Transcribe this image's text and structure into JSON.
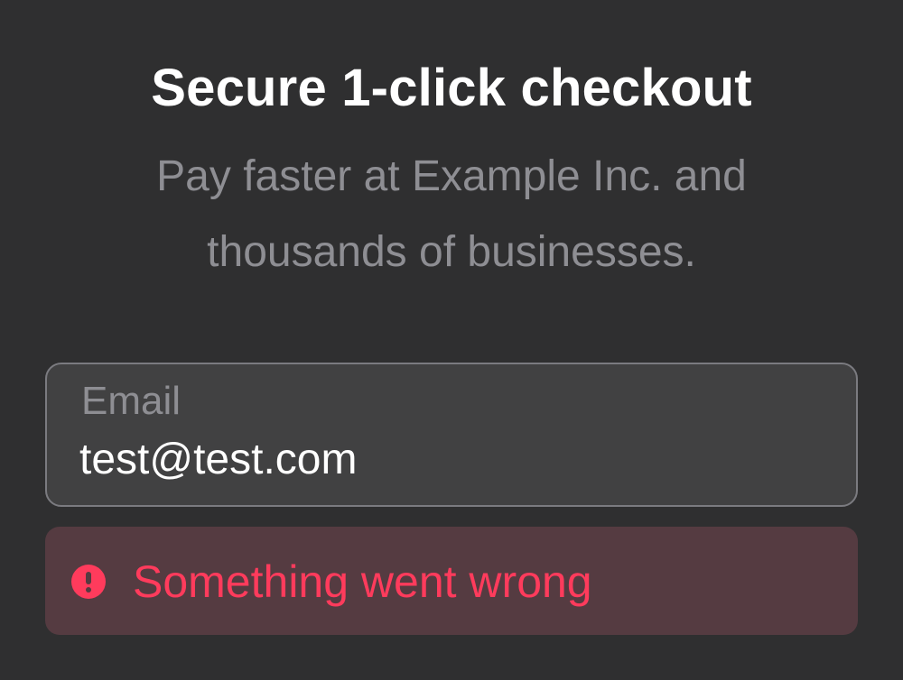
{
  "header": {
    "title": "Secure 1-click checkout",
    "subtitle": "Pay faster at Example Inc. and thousands of businesses."
  },
  "email": {
    "label": "Email",
    "value": "test@test.com"
  },
  "error": {
    "icon": "alert-circle-icon",
    "message": "Something went wrong"
  },
  "colors": {
    "background": "#2f2f30",
    "field_background": "#414142",
    "error_background": "#553b41",
    "error_accent": "#ff3b5c",
    "muted_text": "#8e8e93"
  }
}
